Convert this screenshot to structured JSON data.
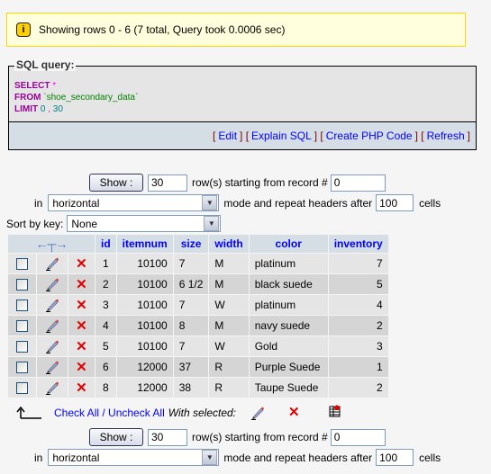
{
  "notice": {
    "icon": "info-icon",
    "message": "Showing rows 0 - 6 (7 total, Query took 0.0006 sec)"
  },
  "sql_query": {
    "legend": "SQL query:",
    "line1_kw": "SELECT",
    "line1_op": "*",
    "line2_kw": "FROM",
    "line2_table": "`shoe_secondary_data`",
    "line3_kw": "LIMIT",
    "line3_a": "0",
    "line3_sep": ",",
    "line3_b": "30",
    "links": [
      "Edit",
      "Explain SQL",
      "Create PHP Code",
      "Refresh"
    ]
  },
  "navigation": {
    "show_label": "Show :",
    "rows_value": "30",
    "rows_text": "row(s) starting from record #",
    "start_value": "0",
    "in_text": "in",
    "mode_value": "horizontal",
    "mode_text": "mode and repeat headers after",
    "repeat_value": "100",
    "cells_text": "cells"
  },
  "sort": {
    "label": "Sort by key:",
    "value": "None"
  },
  "table": {
    "columns": [
      "id",
      "itemnum",
      "size",
      "width",
      "color",
      "inventory"
    ],
    "rows": [
      {
        "id": "1",
        "itemnum": "10100",
        "size": "7",
        "width": "M",
        "color": "platinum",
        "inventory": "7"
      },
      {
        "id": "2",
        "itemnum": "10100",
        "size": "6 1/2",
        "width": "M",
        "color": "black suede",
        "inventory": "5"
      },
      {
        "id": "3",
        "itemnum": "10100",
        "size": "7",
        "width": "W",
        "color": "platinum",
        "inventory": "4"
      },
      {
        "id": "4",
        "itemnum": "10100",
        "size": "8",
        "width": "M",
        "color": "navy suede",
        "inventory": "2"
      },
      {
        "id": "5",
        "itemnum": "10100",
        "size": "7",
        "width": "W",
        "color": "Gold",
        "inventory": "3"
      },
      {
        "id": "6",
        "itemnum": "12000",
        "size": "37",
        "width": "R",
        "color": "Purple Suede",
        "inventory": "1"
      },
      {
        "id": "8",
        "itemnum": "12000",
        "size": "38",
        "width": "R",
        "color": "Taupe Suede",
        "inventory": "2"
      }
    ]
  },
  "bulk": {
    "check_all": "Check All",
    "separator": " / ",
    "uncheck_all": "Uncheck All",
    "with_selected": "With selected:"
  },
  "colors": {
    "notice_bg": "#ffffdd",
    "notice_border": "#ffd700",
    "header_bg": "#d5dde5",
    "row_odd": "#e5e5e5",
    "row_even": "#d5d5d5",
    "link": "#0000ff"
  }
}
